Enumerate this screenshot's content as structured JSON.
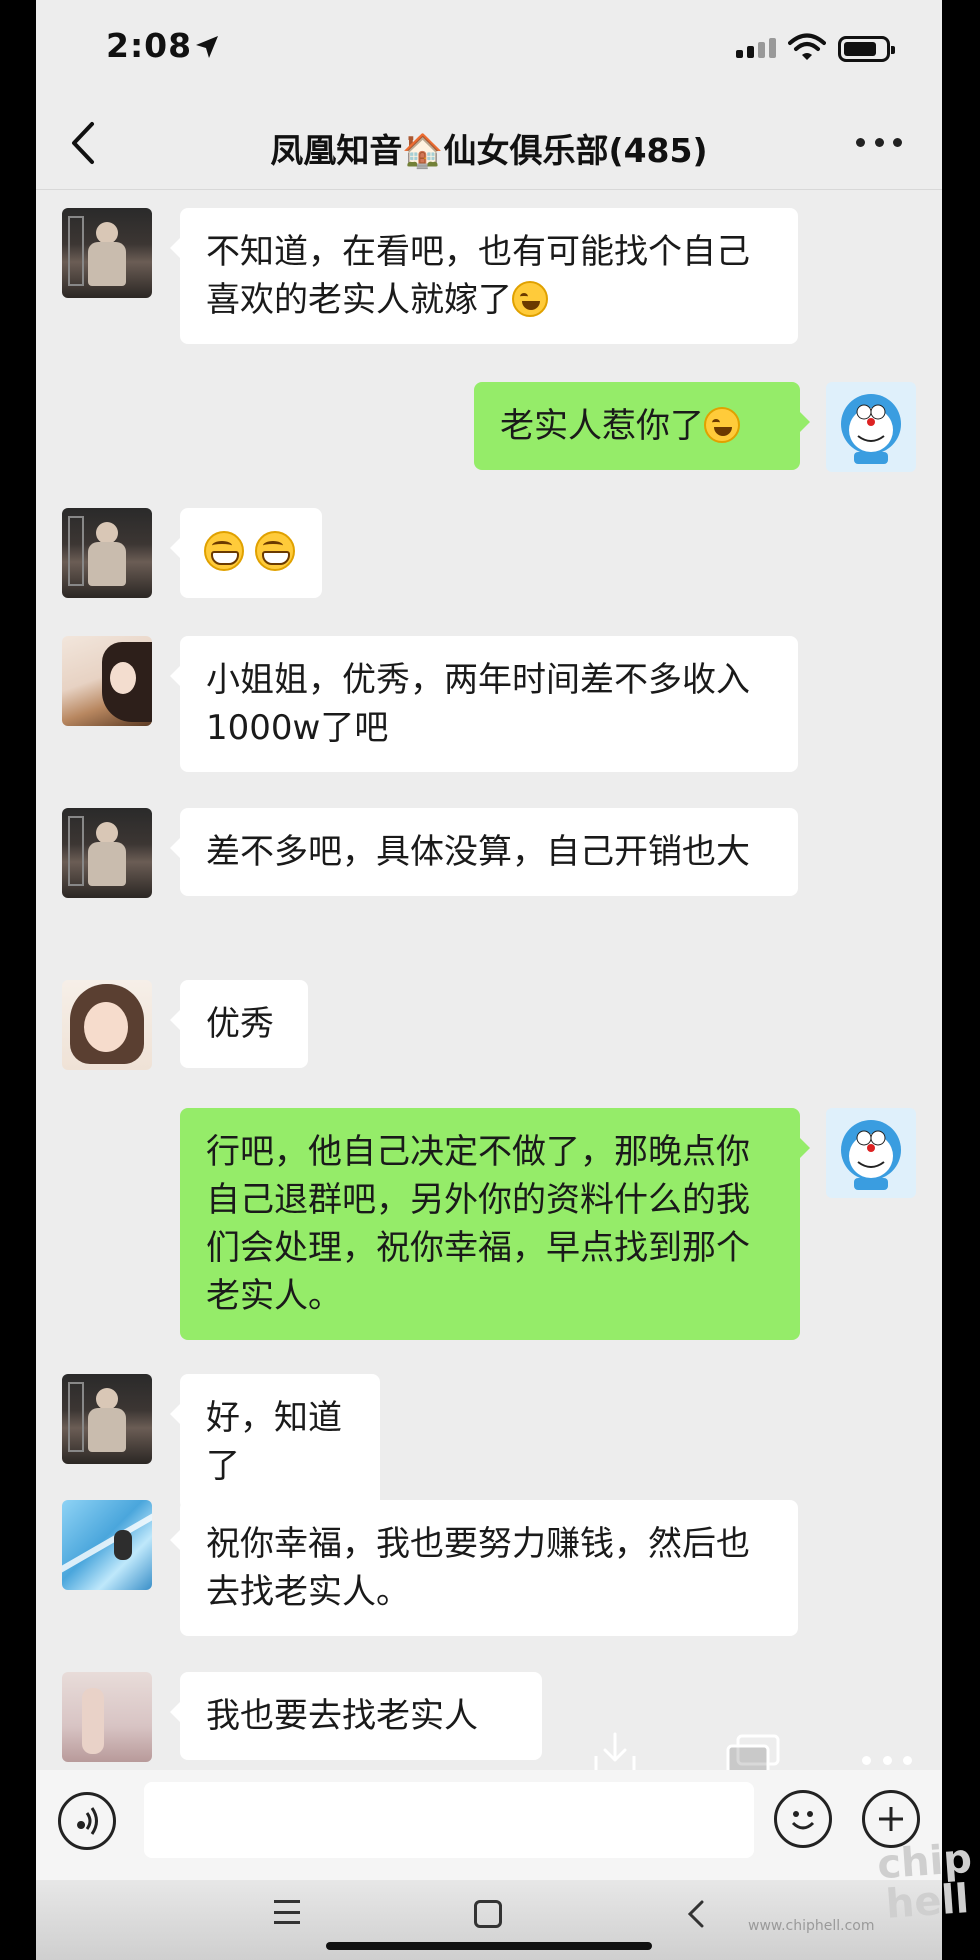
{
  "status_bar": {
    "time": "2:08"
  },
  "header": {
    "title": "凤凰知音🏠仙女俱乐部(485)"
  },
  "messages": [
    {
      "side": "in",
      "avatar": "dark-photo",
      "text": "不知道，在看吧，也有可能找个自己喜欢的老实人就嫁了",
      "emoji": "cry-laugh"
    },
    {
      "side": "out",
      "avatar": "doraemon",
      "text": "老实人惹你了",
      "emoji": "cry-laugh"
    },
    {
      "side": "in",
      "avatar": "dark-photo",
      "text": "",
      "emoji": "grin grin"
    },
    {
      "side": "in",
      "avatar": "girl-dog",
      "text": "小姐姐，优秀，两年时间差不多收入1000w了吧"
    },
    {
      "side": "in",
      "avatar": "dark-photo",
      "text": "差不多吧，具体没算，自己开销也大"
    },
    {
      "side": "in",
      "avatar": "girl-selfie",
      "text": "优秀"
    },
    {
      "side": "out",
      "avatar": "doraemon",
      "text": "行吧，他自己决定不做了，那晚点你自己退群吧，另外你的资料什么的我们会处理，祝你幸福，早点找到那个老实人。"
    },
    {
      "side": "in",
      "avatar": "dark-photo",
      "text": "好，知道了"
    },
    {
      "side": "in",
      "avatar": "pool-photo",
      "text": "祝你幸福，我也要努力赚钱，然后也去找老实人。"
    },
    {
      "side": "in",
      "avatar": "room-photo",
      "text": "我也要去找老实人"
    }
  ],
  "watermark": {
    "logo": "chip hell",
    "url": "www.chiphell.com"
  },
  "icons": [
    "back-icon",
    "more-icon",
    "voice-icon",
    "emoji-icon",
    "plus-icon",
    "download-icon",
    "copy-icon",
    "menu-icon",
    "home-icon"
  ]
}
